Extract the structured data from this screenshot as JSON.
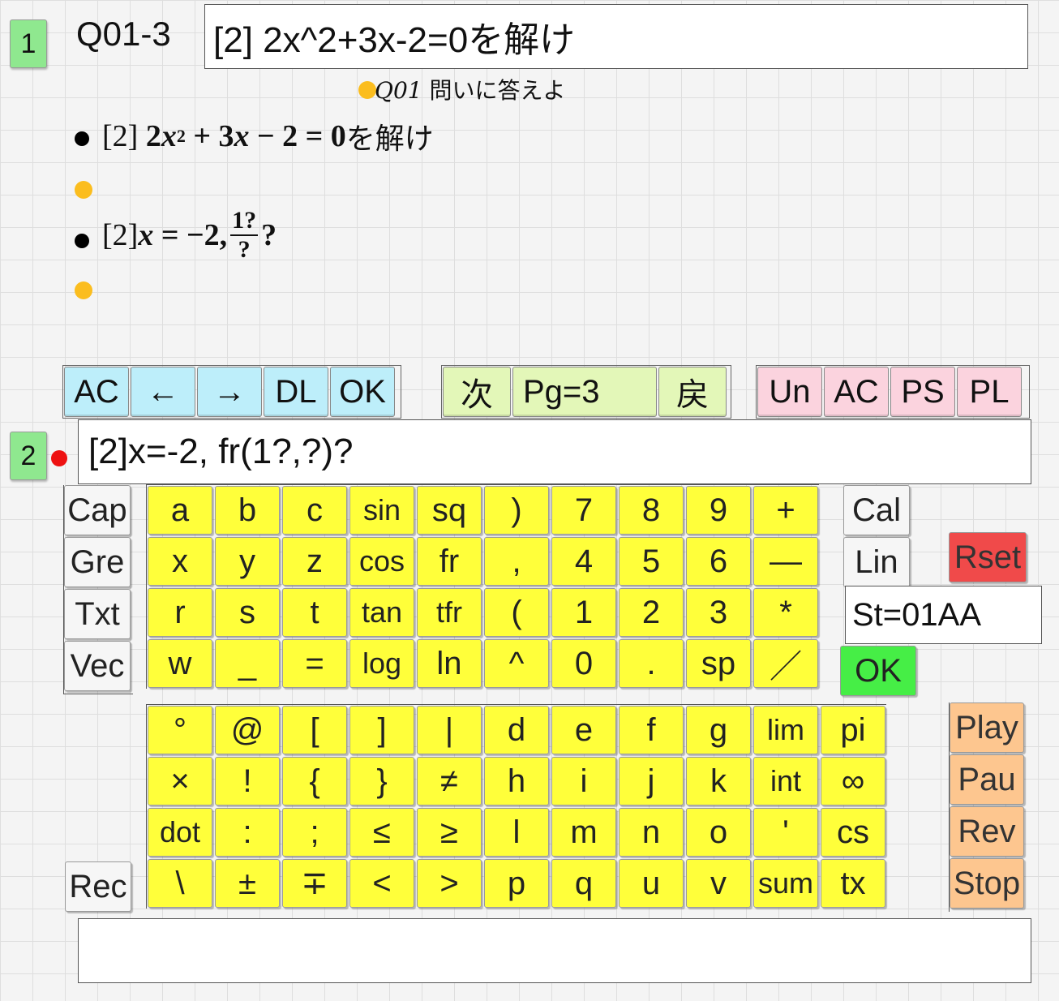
{
  "colors": {
    "line_badge": "#8fe88f",
    "key_yellow": "#ffff3a",
    "toolbar_blue": "#bdeefa",
    "toolbar_green": "#e3f7b8",
    "toolbar_pink": "#fbd3de",
    "rset_red": "#f04a4a",
    "ok_green": "#46ee46",
    "play_orange": "#fdc68f",
    "bullet_orange": "#fbbd1e",
    "active_dot_red": "#ee1111"
  },
  "line1": {
    "number": "1",
    "label": "Q01-3",
    "input": "[2] 2x^2+3x-2=0を解け"
  },
  "preview": {
    "heading_q": "Q01",
    "heading_text": "問いに答えよ",
    "item1": {
      "prefix": "[2]",
      "coef": "2",
      "var1": "x",
      "exp": "2",
      "plus": "+",
      "term2": "3",
      "var2": "x",
      "minus": "−",
      "const": "2",
      "eq": "=",
      "rhs": "0",
      "suffix": "を解け"
    },
    "item2": {
      "prefix": "[2]",
      "var": "x",
      "eq": "=",
      "value": "−2,",
      "numerator": "1?",
      "denominator": "?",
      "suffix": "?"
    }
  },
  "toolbar": {
    "edit": [
      "AC",
      "←",
      "→",
      "DL",
      "OK"
    ],
    "next": "次",
    "page": "Pg=3",
    "back": "戻",
    "misc": [
      "Un",
      "AC",
      "PS",
      "PL"
    ]
  },
  "line2": {
    "number": "2",
    "input": "[2]x=-2, fr(1?,?)?"
  },
  "left_keys": [
    "Cap",
    "Gre",
    "Txt",
    "Vec"
  ],
  "main_keys": [
    "a",
    "b",
    "c",
    "sin",
    "sq",
    ")",
    "7",
    "8",
    "9",
    "+",
    "x",
    "y",
    "z",
    "cos",
    "fr",
    ",",
    "4",
    "5",
    "6",
    "—",
    "r",
    "s",
    "t",
    "tan",
    "tfr",
    "(",
    "1",
    "2",
    "3",
    "*",
    "w",
    "_",
    "=",
    "log",
    "ln",
    "^",
    "0",
    ".",
    "sp",
    "／"
  ],
  "right_keys": {
    "cal": "Cal",
    "lin": "Lin",
    "rset": "Rset",
    "status": "St=01AA",
    "ok": "OK"
  },
  "lower_keys": [
    "°",
    "@",
    "[",
    "]",
    "|",
    "d",
    "e",
    "f",
    "g",
    "lim",
    "pi",
    "×",
    "!",
    "{",
    "}",
    "≠",
    "h",
    "i",
    "j",
    "k",
    "int",
    "∞",
    "dot",
    ":",
    ";",
    "≤",
    "≥",
    "l",
    "m",
    "n",
    "o",
    "'",
    "cs",
    "\\",
    "±",
    "∓",
    "<",
    ">",
    "p",
    "q",
    "u",
    "v",
    "sum",
    "tx"
  ],
  "rec": "Rec",
  "player": [
    "Play",
    "Pau",
    "Rev",
    "Stop"
  ],
  "bottom_input": ""
}
